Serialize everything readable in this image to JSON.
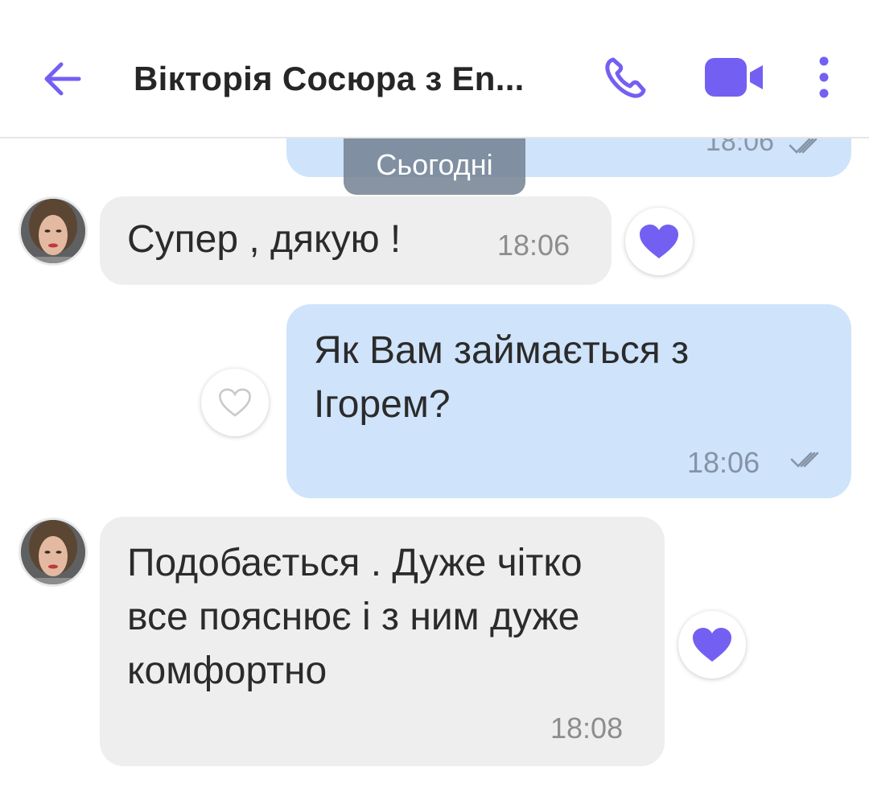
{
  "header": {
    "title": "Вікторія Сосюра з En...",
    "back_icon": "arrow-left-icon",
    "call_icon": "phone-icon",
    "video_icon": "video-camera-icon",
    "menu_icon": "more-vertical-icon"
  },
  "colors": {
    "accent": "#7360f2",
    "incoming_bubble": "#eeeeee",
    "outgoing_bubble": "#cfe3fb",
    "like_active": "#7360f2",
    "like_inactive": "#c9c9c9"
  },
  "chat": {
    "date_separator": "Сьогодні",
    "previous_message_time": "18:06",
    "messages": [
      {
        "direction": "incoming",
        "text": "Супер , дякую !",
        "time": "18:06",
        "liked": true
      },
      {
        "direction": "outgoing",
        "text": "Як Вам займається з Ігорем?",
        "time": "18:06",
        "status": "read",
        "liked": false
      },
      {
        "direction": "incoming",
        "text": "Подобається . Дуже чітко все пояснює і з ним дуже комфортно",
        "time": "18:08",
        "liked": true
      }
    ]
  }
}
